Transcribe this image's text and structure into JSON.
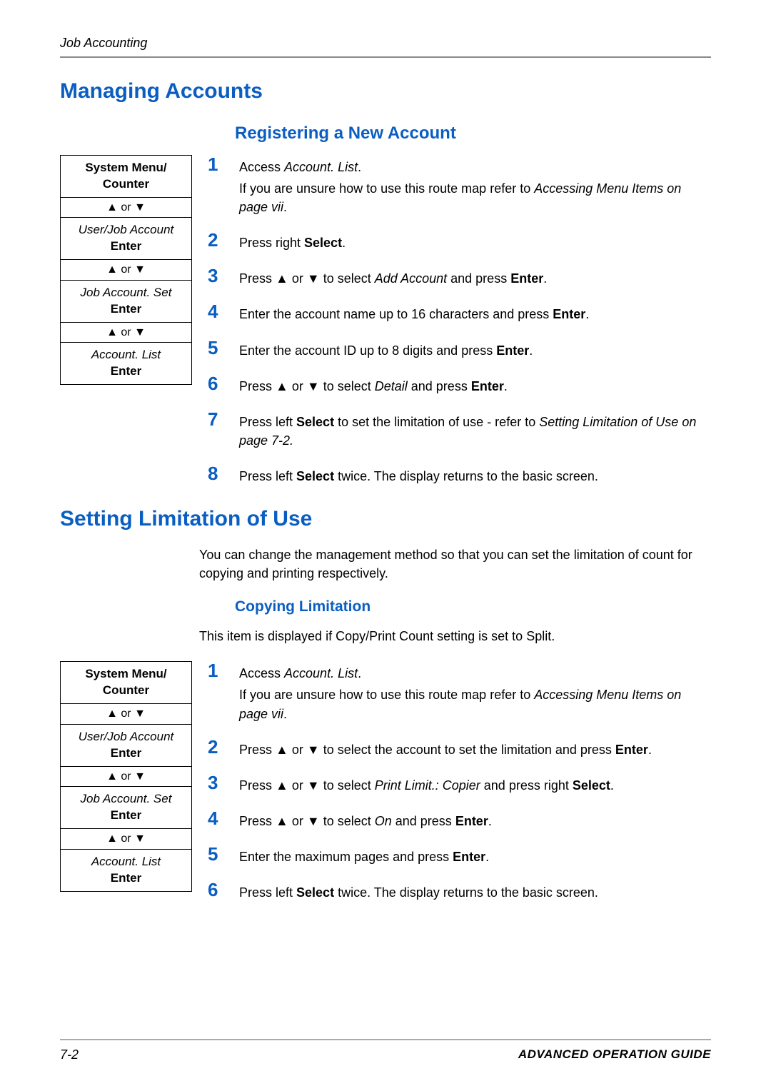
{
  "header": {
    "breadcrumb": "Job Accounting"
  },
  "h1_managing": "Managing Accounts",
  "h2_registering": "Registering a New Account",
  "menu1": {
    "r1_line1": "System Menu/",
    "r1_line2": "Counter",
    "r2_or": " or ",
    "r3_line1": "User/Job Account",
    "r3_line2": "Enter",
    "r4_or": " or ",
    "r5_line1": "Job Account. Set",
    "r5_line2": "Enter",
    "r6_or": " or ",
    "r7_line1": "Account. List",
    "r7_line2": "Enter"
  },
  "steps1": {
    "s1": {
      "n": "1",
      "a1": "Access ",
      "a2_i": "Account. List",
      "a3": ".",
      "b1": "If you are unsure how to use this route map refer to ",
      "b2_i": "Accessing Menu Items on page vii",
      "b3": "."
    },
    "s2": {
      "n": "2",
      "a1": "Press right ",
      "a2_b": "Select",
      "a3": "."
    },
    "s3": {
      "n": "3",
      "a1": "Press ",
      "a2_or": " or ",
      "a3": " to select ",
      "a4_i": "Add Account",
      "a5": " and press ",
      "a6_b": "Enter",
      "a7": "."
    },
    "s4": {
      "n": "4",
      "a1": "Enter the account name up to 16 characters and press ",
      "a2_b": "Enter",
      "a3": "."
    },
    "s5": {
      "n": "5",
      "a1": "Enter the account ID up to 8 digits and press ",
      "a2_b": "Enter",
      "a3": "."
    },
    "s6": {
      "n": "6",
      "a1": "Press ",
      "a2_or": " or ",
      "a3": " to select ",
      "a4_i": "Detail",
      "a5": " and press ",
      "a6_b": "Enter",
      "a7": "."
    },
    "s7": {
      "n": "7",
      "a1": "Press left ",
      "a2_b": "Select",
      "a3": " to set the limitation of use - refer to ",
      "a4_i": "Setting Limitation of Use on page 7-2.",
      "a5": ""
    },
    "s8": {
      "n": "8",
      "a1": "Press left ",
      "a2_b": "Select",
      "a3": " twice. The display returns to the basic screen."
    }
  },
  "h1_setting": "Setting Limitation of Use",
  "setting_intro": "You can change the management method so that you can set the limitation of count for copying and printing respectively.",
  "h3_copying": "Copying Limitation",
  "copying_intro": "This item is displayed if Copy/Print Count setting is set to Split.",
  "menu2": {
    "r1_line1": "System Menu/",
    "r1_line2": "Counter",
    "r2_or": " or ",
    "r3_line1": "User/Job Account",
    "r3_line2": "Enter",
    "r4_or": " or ",
    "r5_line1": "Job Account. Set",
    "r5_line2": "Enter",
    "r6_or": " or ",
    "r7_line1": "Account. List",
    "r7_line2": "Enter"
  },
  "steps2": {
    "s1": {
      "n": "1",
      "a1": "Access ",
      "a2_i": "Account. List",
      "a3": ".",
      "b1": "If you are unsure how to use this route map refer to ",
      "b2_i": "Accessing Menu Items on page vii",
      "b3": "."
    },
    "s2": {
      "n": "2",
      "a1": "Press ",
      "a2_or": " or ",
      "a3": " to select the account to set the limitation and press ",
      "a4_b": "Enter",
      "a5": "."
    },
    "s3": {
      "n": "3",
      "a1": "Press ",
      "a2_or": " or ",
      "a3": " to select ",
      "a4_i": "Print Limit.: Copier",
      "a5": " and press right ",
      "a6_b": "Select",
      "a7": "."
    },
    "s4": {
      "n": "4",
      "a1": "Press ",
      "a2_or": " or ",
      "a3": " to select ",
      "a4_i": "On",
      "a5": " and press ",
      "a6_b": "Enter",
      "a7": "."
    },
    "s5": {
      "n": "5",
      "a1": "Enter the maximum pages and press ",
      "a2_b": "Enter",
      "a3": "."
    },
    "s6": {
      "n": "6",
      "a1": "Press left ",
      "a2_b": "Select",
      "a3": " twice. The display returns to the basic screen."
    }
  },
  "footer": {
    "page": "7-2",
    "guide": "ADVANCED OPERATION GUIDE"
  }
}
